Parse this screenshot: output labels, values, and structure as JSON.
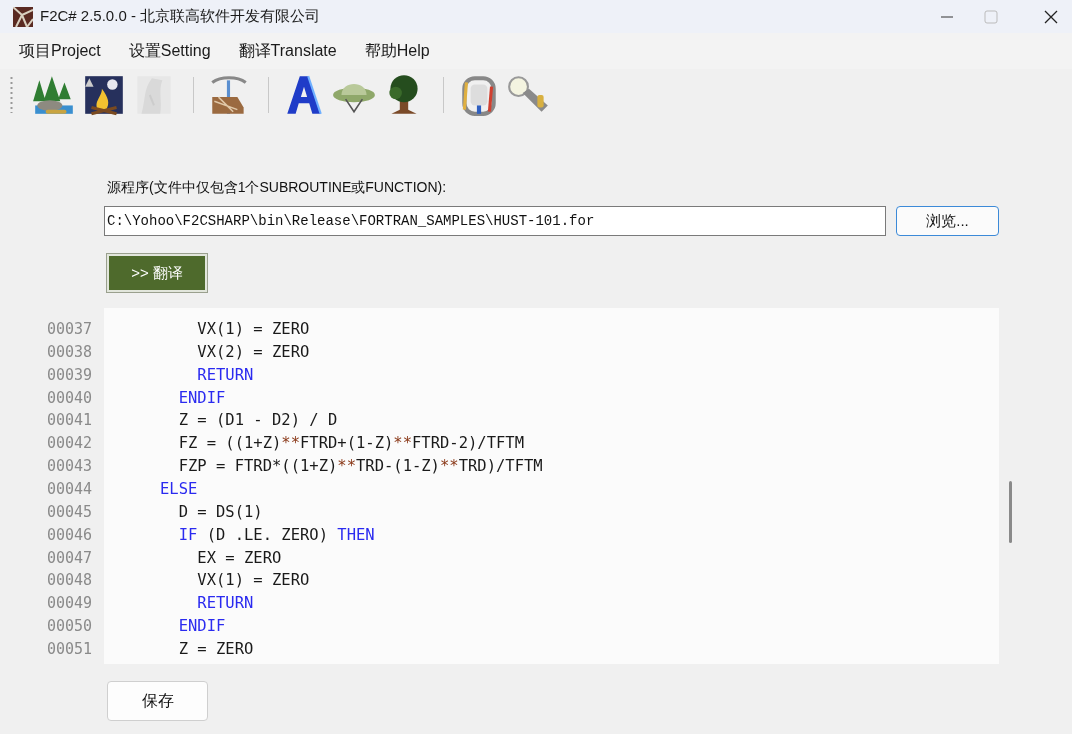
{
  "window": {
    "title": "F2C# 2.5.0.0 - 北京联高软件开发有限公司"
  },
  "menu": [
    {
      "label": "项目Project"
    },
    {
      "label": "设置Setting"
    },
    {
      "label": "翻译Translate"
    },
    {
      "label": "帮助Help"
    }
  ],
  "toolbar": [
    {
      "kind": "button",
      "disabled": false
    },
    {
      "kind": "button",
      "disabled": false
    },
    {
      "kind": "button",
      "disabled": true
    },
    {
      "kind": "separator"
    },
    {
      "kind": "button",
      "disabled": false
    },
    {
      "kind": "separator"
    },
    {
      "kind": "button",
      "disabled": false
    },
    {
      "kind": "button",
      "disabled": false
    },
    {
      "kind": "button",
      "disabled": false
    },
    {
      "kind": "separator"
    },
    {
      "kind": "button",
      "disabled": false
    },
    {
      "kind": "button",
      "disabled": false
    }
  ],
  "source": {
    "label": "源程序(文件中仅包含1个SUBROUTINE或FUNCTION):",
    "value": "C:\\Yohoo\\F2CSHARP\\bin\\Release\\FORTRAN_SAMPLES\\HUST-101.for",
    "browse_button": "浏览..."
  },
  "translate_button": ">> 翻译",
  "editor": {
    "lines": [
      {
        "number": "00037",
        "segments": [
          {
            "text": "          VX(1) = ZERO",
            "kind": "plain"
          }
        ]
      },
      {
        "number": "00038",
        "segments": [
          {
            "text": "          VX(2) = ZERO",
            "kind": "plain"
          }
        ]
      },
      {
        "number": "00039",
        "segments": [
          {
            "text": "          RETURN",
            "kind": "keyword"
          }
        ]
      },
      {
        "number": "00040",
        "segments": [
          {
            "text": "        ENDIF",
            "kind": "keyword"
          }
        ]
      },
      {
        "number": "00041",
        "segments": [
          {
            "text": "        Z = (D1 - D2) / D",
            "kind": "plain"
          }
        ]
      },
      {
        "number": "00042",
        "segments": [
          {
            "text": "        FZ = ((1+Z)",
            "kind": "plain"
          },
          {
            "text": "**",
            "kind": "operator"
          },
          {
            "text": "FTRD+(1-Z)",
            "kind": "plain"
          },
          {
            "text": "**",
            "kind": "operator"
          },
          {
            "text": "FTRD-2)/TFTM",
            "kind": "plain"
          }
        ]
      },
      {
        "number": "00043",
        "segments": [
          {
            "text": "        FZP = FTRD*((1+Z)",
            "kind": "plain"
          },
          {
            "text": "**",
            "kind": "operator"
          },
          {
            "text": "TRD-(1-Z)",
            "kind": "plain"
          },
          {
            "text": "**",
            "kind": "operator"
          },
          {
            "text": "TRD)/TFTM",
            "kind": "plain"
          }
        ]
      },
      {
        "number": "00044",
        "segments": [
          {
            "text": "      ELSE",
            "kind": "keyword"
          }
        ]
      },
      {
        "number": "00045",
        "segments": [
          {
            "text": "        D = DS(1)",
            "kind": "plain"
          }
        ]
      },
      {
        "number": "00046",
        "segments": [
          {
            "text": "        IF",
            "kind": "keyword"
          },
          {
            "text": " (D .LE. ZERO) ",
            "kind": "plain"
          },
          {
            "text": "THEN",
            "kind": "keyword"
          }
        ]
      },
      {
        "number": "00047",
        "segments": [
          {
            "text": "          EX = ZERO",
            "kind": "plain"
          }
        ]
      },
      {
        "number": "00048",
        "segments": [
          {
            "text": "          VX(1) = ZERO",
            "kind": "plain"
          }
        ]
      },
      {
        "number": "00049",
        "segments": [
          {
            "text": "          RETURN",
            "kind": "keyword"
          }
        ]
      },
      {
        "number": "00050",
        "segments": [
          {
            "text": "        ENDIF",
            "kind": "keyword"
          }
        ]
      },
      {
        "number": "00051",
        "segments": [
          {
            "text": "        Z = ZERO",
            "kind": "plain"
          }
        ]
      }
    ]
  },
  "save_button": "保存"
}
